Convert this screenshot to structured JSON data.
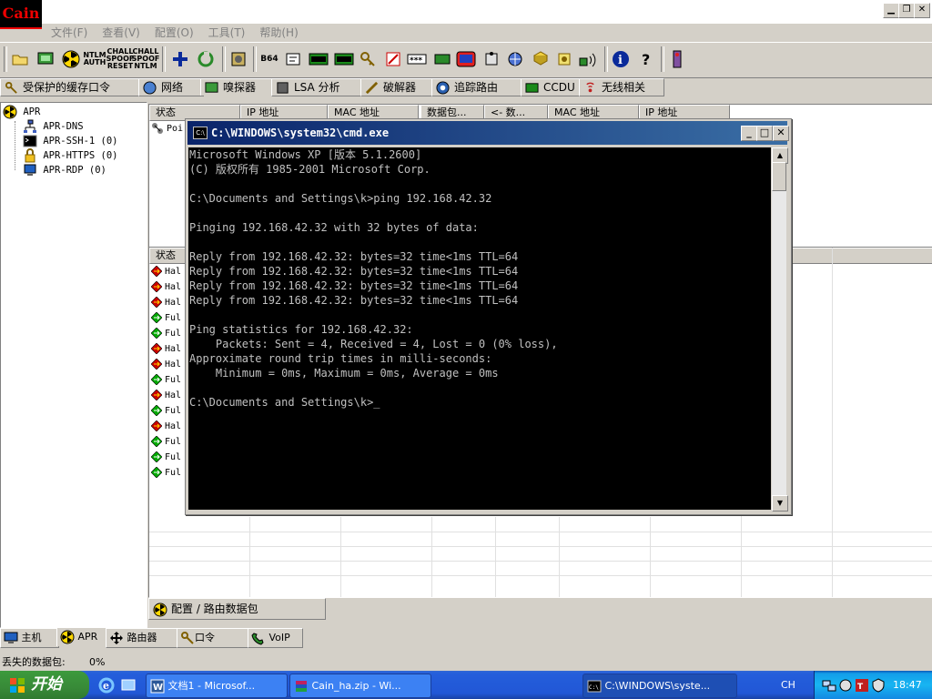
{
  "app": {
    "logo_text": "Cain",
    "menus": [
      "文件(F)",
      "查看(V)",
      "配置(O)",
      "工具(T)",
      "帮助(H)"
    ]
  },
  "toolbar": {
    "ntlm_auth_label": "NTLM AUTH",
    "chall_spoof_reset_label": "CHALL SPOOF RESET",
    "chall_spoof_ntlm_label": "CHALL SPOOF NTLM",
    "b64_label": "B64"
  },
  "top_tabs": [
    "受保护的缓存口令",
    "网络",
    "嗅探器",
    "LSA 分析",
    "破解器",
    "追踪路由",
    "CCDU",
    "无线相关"
  ],
  "tree": {
    "root": "APR",
    "children": [
      "APR-DNS",
      "APR-SSH-1  (0)",
      "APR-HTTPS  (0)",
      "APR-RDP  (0)"
    ]
  },
  "upper_table": {
    "headers": [
      "状态",
      "IP 地址",
      "MAC 地址",
      "数据包...",
      "<- 数...",
      "MAC 地址",
      "IP 地址"
    ],
    "first_row_status": "Poi"
  },
  "lower_table": {
    "header": "状态",
    "rows": [
      {
        "status": "Hal",
        "kind": "half"
      },
      {
        "status": "Hal",
        "kind": "half"
      },
      {
        "status": "Hal",
        "kind": "half"
      },
      {
        "status": "Ful",
        "kind": "full"
      },
      {
        "status": "Ful",
        "kind": "full"
      },
      {
        "status": "Hal",
        "kind": "half"
      },
      {
        "status": "Hal",
        "kind": "half"
      },
      {
        "status": "Ful",
        "kind": "full"
      },
      {
        "status": "Hal",
        "kind": "half"
      },
      {
        "status": "Ful",
        "kind": "full"
      },
      {
        "status": "Hal",
        "kind": "half"
      },
      {
        "status": "Ful",
        "kind": "full"
      },
      {
        "status": "Ful",
        "kind": "full"
      },
      {
        "status": "Ful",
        "kind": "full"
      }
    ]
  },
  "cmd": {
    "title": "C:\\WINDOWS\\system32\\cmd.exe",
    "icon_text": "C:\\",
    "lines": [
      "Microsoft Windows XP [版本 5.1.2600]",
      "(C) 版权所有 1985-2001 Microsoft Corp.",
      "",
      "C:\\Documents and Settings\\k>ping 192.168.42.32",
      "",
      "Pinging 192.168.42.32 with 32 bytes of data:",
      "",
      "Reply from 192.168.42.32: bytes=32 time<1ms TTL=64",
      "Reply from 192.168.42.32: bytes=32 time<1ms TTL=64",
      "Reply from 192.168.42.32: bytes=32 time<1ms TTL=64",
      "Reply from 192.168.42.32: bytes=32 time<1ms TTL=64",
      "",
      "Ping statistics for 192.168.42.32:",
      "    Packets: Sent = 4, Received = 4, Lost = 0 (0% loss),",
      "Approximate round trip times in milli-seconds:",
      "    Minimum = 0ms, Maximum = 0ms, Average = 0ms",
      "",
      "C:\\Documents and Settings\\k>_"
    ]
  },
  "bottom_tab": "配置 / 路由数据包",
  "main_tabs": [
    "主机",
    "APR",
    "路由器",
    "口令",
    "VoIP"
  ],
  "status_bar": {
    "label": "丢失的数据包:",
    "value": "0%"
  },
  "taskbar": {
    "start_label": "开始",
    "buttons": [
      "文档1 - Microsof...",
      "Cain_ha.zip - Wi...",
      "C:\\WINDOWS\\syste..."
    ],
    "language": "CH",
    "clock": "18:47"
  },
  "colors": {
    "half_duplex": "#cc0000",
    "full_duplex": "#00aa00",
    "taskbar_blue": "#245edb",
    "start_green": "#388a38",
    "cmd_title_blue": "#0a246a"
  }
}
